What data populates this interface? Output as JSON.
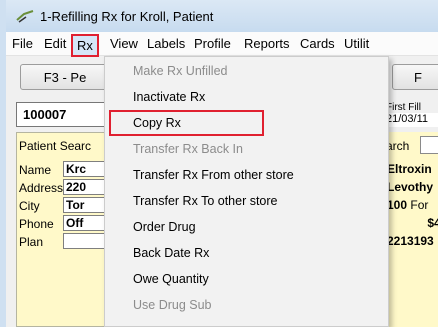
{
  "window": {
    "title": "1-Refilling Rx for Kroll, Patient"
  },
  "menubar": {
    "items": [
      "File",
      "Edit",
      "Rx",
      "View",
      "Labels",
      "Profile",
      "Reports",
      "Cards",
      "Utilit"
    ]
  },
  "toolbar": {
    "f3_label": "F3 - Pe",
    "right_label": "F"
  },
  "rx_number": "100007",
  "patient": {
    "heading": "Patient Searc",
    "fields": [
      {
        "label": "Name",
        "value": "Krc"
      },
      {
        "label": "Address",
        "value": "220"
      },
      {
        "label": "City",
        "value": "Tor"
      },
      {
        "label": "Phone",
        "value": "Off"
      },
      {
        "label": "Plan",
        "value": ""
      }
    ]
  },
  "right_panel": {
    "first_fill_label": "First Fill",
    "first_fill_value": "21/03/11",
    "search_label": "arch",
    "drug_1": "Eltroxin",
    "drug_2": "Levothy",
    "qty": "100",
    "qty_suffix": "For",
    "price": "$4.",
    "din": "2213193"
  },
  "rx_menu": {
    "items": [
      {
        "label": "Make Rx Unfilled",
        "enabled": false
      },
      {
        "label": "Inactivate Rx",
        "enabled": true
      },
      {
        "label": "Copy Rx",
        "enabled": true,
        "highlighted": true
      },
      {
        "label": "Transfer Rx Back In",
        "enabled": false
      },
      {
        "label": "Transfer Rx From other store",
        "enabled": true
      },
      {
        "label": "Transfer Rx To other store",
        "enabled": true
      },
      {
        "label": "Order Drug",
        "enabled": true
      },
      {
        "label": "Back Date Rx",
        "enabled": true
      },
      {
        "label": "Owe Quantity",
        "enabled": true
      },
      {
        "label": "Use Drug Sub",
        "enabled": false
      }
    ]
  },
  "colors": {
    "highlight_border": "#e02030",
    "panel_yellow": "#fff9c9"
  }
}
